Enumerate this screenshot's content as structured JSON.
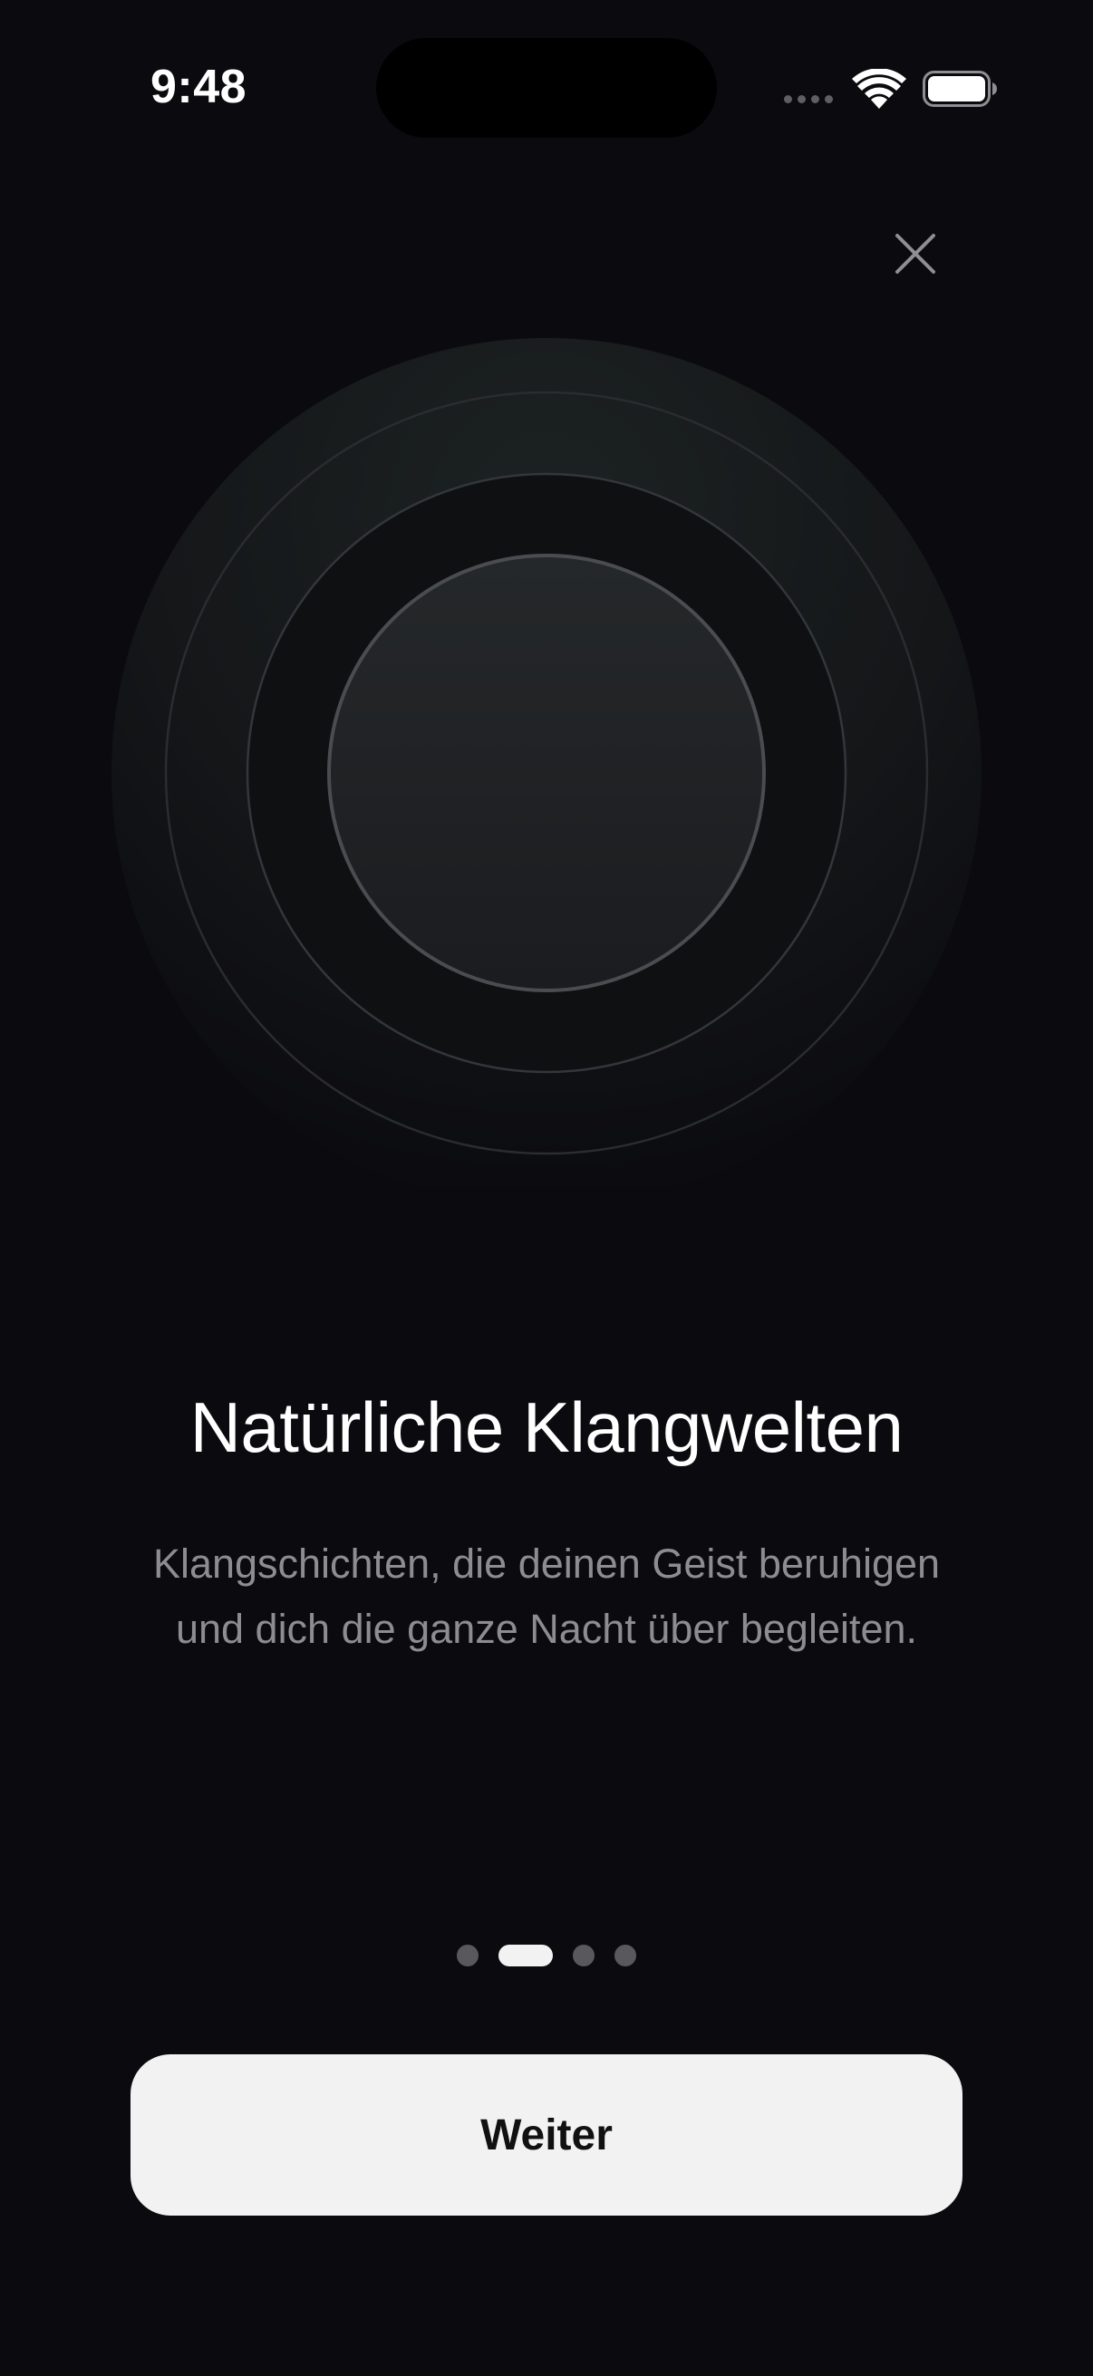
{
  "status_bar": {
    "time": "9:48",
    "signal_icon": "cellular-signal-icon",
    "wifi_icon": "wifi-icon",
    "battery_icon": "battery-icon"
  },
  "header": {
    "close_icon": "close-icon"
  },
  "illustration": {
    "type": "concentric-circles",
    "accent_color": "#1c2222"
  },
  "content": {
    "title": "Natürliche Klangwelten",
    "description": "Klangschichten, die deinen Geist beruhigen und dich die ganze Nacht über begleiten."
  },
  "pagination": {
    "total": 4,
    "current": 2
  },
  "primary_action": {
    "label": "Weiter"
  },
  "colors": {
    "background": "#0b0b0f",
    "button_bg": "#f2f2f2",
    "button_text": "#111111",
    "secondary_text": "#8c8c91",
    "dot_inactive": "#58585d",
    "dot_active": "#f2f2f2"
  }
}
